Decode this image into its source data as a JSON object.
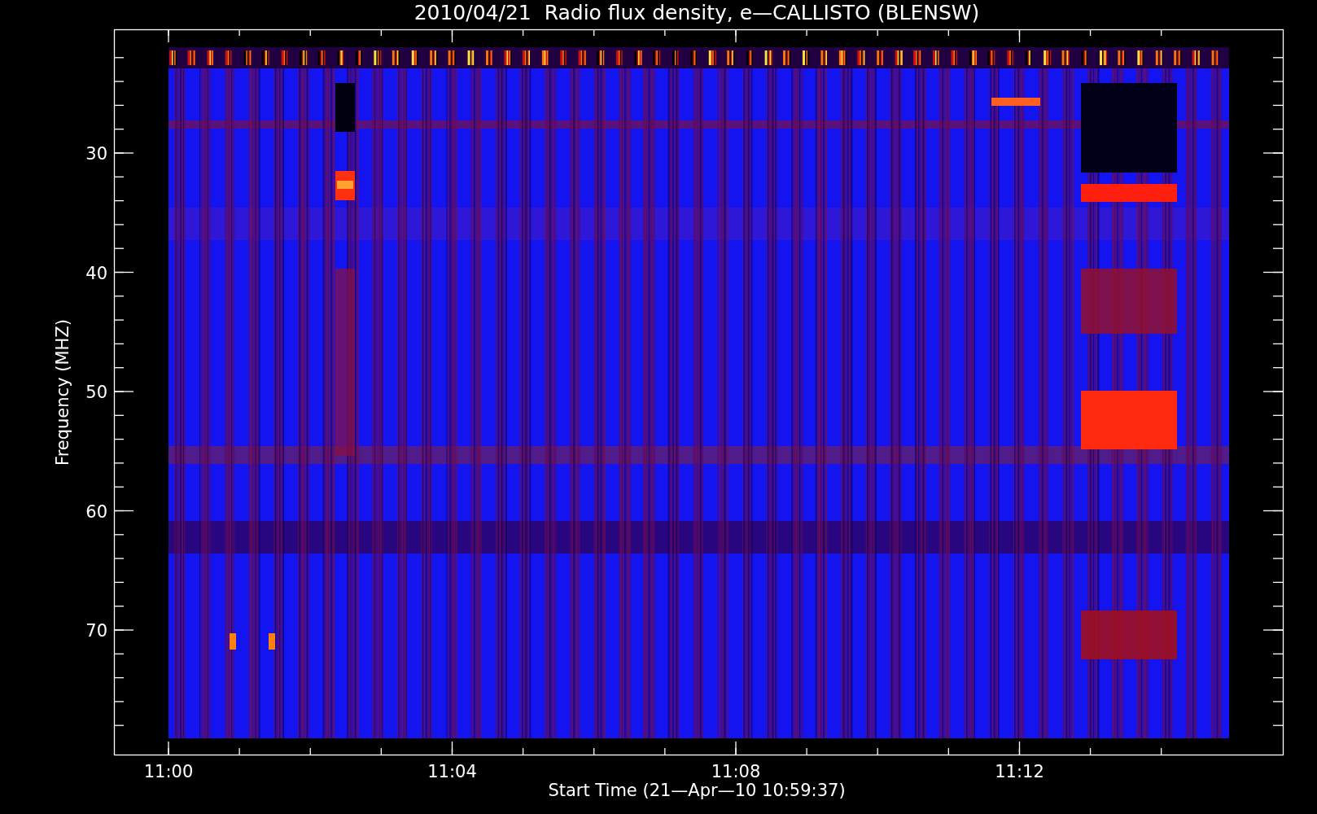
{
  "title": "2010/04/21  Radio flux density, e—CALLISTO (BLENSW)",
  "y_axis": {
    "label": "Frequency (MHZ)",
    "ticks": [
      "30",
      "40",
      "50",
      "60",
      "70"
    ]
  },
  "x_axis": {
    "label": "Start Time (21—Apr—10 10:59:37)",
    "ticks": [
      "11:00",
      "11:04",
      "11:08",
      "11:12"
    ]
  }
}
